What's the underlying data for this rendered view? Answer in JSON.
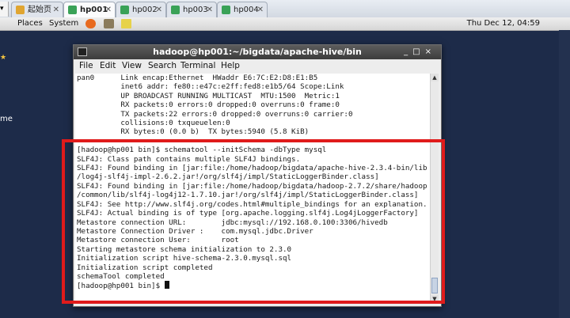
{
  "browser": {
    "tabs": [
      {
        "label": "起始页",
        "icon": "home-icon",
        "active": false
      },
      {
        "label": "hp001",
        "icon": "terminal-tab-icon",
        "active": true
      },
      {
        "label": "hp002",
        "icon": "terminal-tab-icon",
        "active": false
      },
      {
        "label": "hp003",
        "icon": "terminal-tab-icon",
        "active": false
      },
      {
        "label": "hp004",
        "icon": "terminal-tab-icon",
        "active": false
      }
    ],
    "close_glyph": "✕"
  },
  "panel": {
    "places": "Places",
    "system": "System",
    "clock": "Thu Dec 12, 04:59"
  },
  "desktop": {
    "partial_label": "me"
  },
  "terminal": {
    "title": "hadoop@hp001:~/bigdata/apache-hive/bin",
    "menu": [
      "File",
      "Edit",
      "View",
      "Search",
      "Terminal",
      "Help"
    ],
    "lines": [
      "pan0      Link encap:Ethernet  HWaddr E6:7C:E2:D8:E1:B5",
      "          inet6 addr: fe80::e47c:e2ff:fed8:e1b5/64 Scope:Link",
      "          UP BROADCAST RUNNING MULTICAST  MTU:1500  Metric:1",
      "          RX packets:0 errors:0 dropped:0 overruns:0 frame:0",
      "          TX packets:22 errors:0 dropped:0 overruns:0 carrier:0",
      "          collisions:0 txqueuelen:0",
      "          RX bytes:0 (0.0 b)  TX bytes:5940 (5.8 KiB)",
      "",
      "[hadoop@hp001 bin]$ schematool --initSchema -dbType mysql",
      "SLF4J: Class path contains multiple SLF4J bindings.",
      "SLF4J: Found binding in [jar:file:/home/hadoop/bigdata/apache-hive-2.3.4-bin/lib",
      "/log4j-slf4j-impl-2.6.2.jar!/org/slf4j/impl/StaticLoggerBinder.class]",
      "SLF4J: Found binding in [jar:file:/home/hadoop/bigdata/hadoop-2.7.2/share/hadoop",
      "/common/lib/slf4j-log4j12-1.7.10.jar!/org/slf4j/impl/StaticLoggerBinder.class]",
      "SLF4J: See http://www.slf4j.org/codes.html#multiple_bindings for an explanation.",
      "SLF4J: Actual binding is of type [org.apache.logging.slf4j.Log4jLoggerFactory]",
      "Metastore connection URL:        jdbc:mysql://192.168.0.100:3306/hivedb",
      "Metastore Connection Driver :    com.mysql.jdbc.Driver",
      "Metastore connection User:       root",
      "Starting metastore schema initialization to 2.3.0",
      "Initialization script hive-schema-2.3.0.mysql.sql",
      "Initialization script completed",
      "schemaTool completed"
    ],
    "prompt": "[hadoop@hp001 bin]$ "
  },
  "colors": {
    "highlight": "#e01b1b",
    "desktop": "#1d2b49"
  }
}
